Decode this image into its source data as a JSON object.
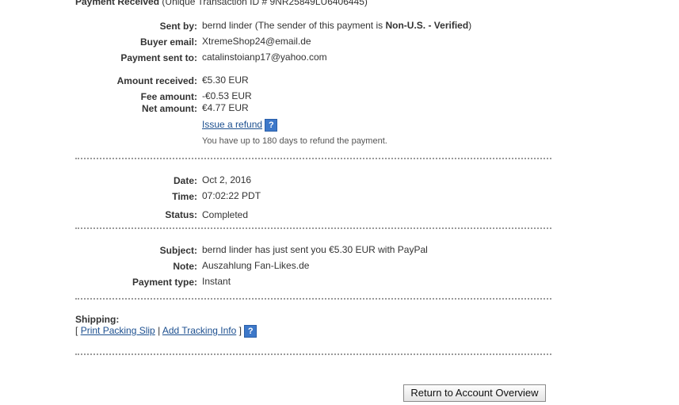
{
  "header": {
    "title": "Payment Received",
    "id_prefix": "(Unique Transaction ID #",
    "transaction_id": "9NR25849LU6406445",
    "id_suffix": ")"
  },
  "party": {
    "sent_by_label": "Sent by:",
    "sender_name": "bernd linder",
    "sender_note_prefix": "(The sender of this payment is",
    "sender_status": "Non-U.S. - Verified",
    "sender_note_suffix": ")",
    "buyer_email_label": "Buyer email:",
    "buyer_email": "XtremeShop24@email.de",
    "sent_to_label": "Payment sent to:",
    "sent_to": "catalinstoianp17@yahoo.com"
  },
  "amounts": {
    "received_label": "Amount received:",
    "received": "€5.30 EUR",
    "fee_label": "Fee amount:",
    "fee": "-€0.53 EUR",
    "net_label": "Net amount:",
    "net": "€4.77 EUR",
    "refund_link": "Issue a refund",
    "refund_help_icon": "?",
    "refund_note": "You have up to 180 days to refund the payment."
  },
  "when": {
    "date_label": "Date:",
    "date": "Oct 2, 2016",
    "time_label": "Time:",
    "time": "07:02:22 PDT",
    "status_label": "Status:",
    "status": "Completed"
  },
  "details": {
    "subject_label": "Subject:",
    "subject": "bernd linder has just sent you €5.30 EUR with PayPal",
    "note_label": "Note:",
    "note": "Auszahlung Fan-Likes.de",
    "type_label": "Payment type:",
    "type": "Instant"
  },
  "shipping": {
    "label": "Shipping:",
    "open_bracket": "[",
    "print_slip": "Print Packing Slip",
    "separator": "|",
    "add_tracking": "Add Tracking Info",
    "close_bracket": "]",
    "help_icon": "?"
  },
  "actions": {
    "return_button": "Return to Account Overview"
  },
  "colors": {
    "link": "#1c4f8f",
    "help_icon_bg": "#3d78c9",
    "text": "#333333",
    "divider": "#9a9a9a"
  }
}
